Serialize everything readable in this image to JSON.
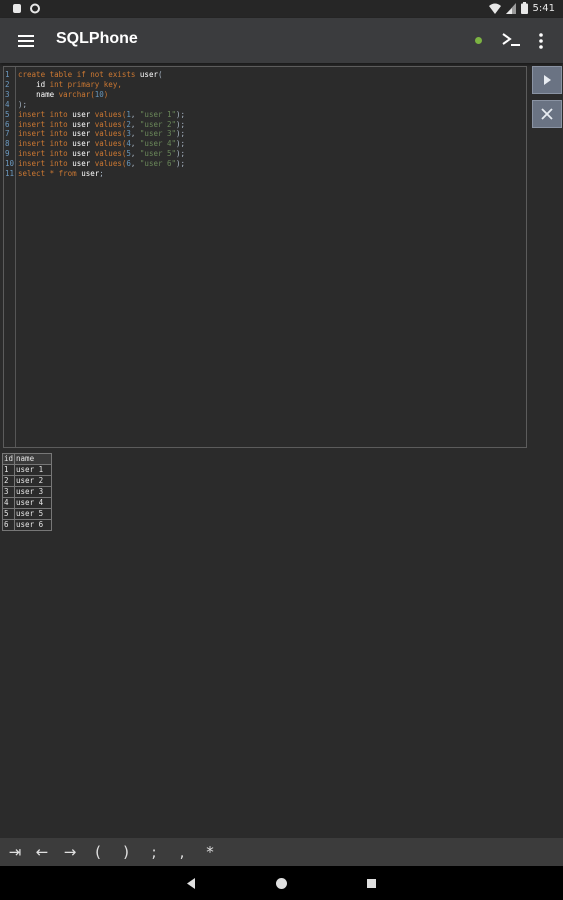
{
  "status": {
    "time": "5:41"
  },
  "app": {
    "title": "SQLPhone"
  },
  "editor": {
    "lines": [
      {
        "n": "1",
        "segs": [
          [
            "create table if not exists ",
            "#cc7832"
          ],
          [
            "user",
            "#ffffff"
          ],
          [
            "(",
            "#a9b7c6"
          ]
        ]
      },
      {
        "n": "2",
        "segs": [
          [
            "    ",
            "#a9b7c6"
          ],
          [
            "id",
            "#ffffff"
          ],
          [
            " int primary key,",
            "#cc7832"
          ]
        ]
      },
      {
        "n": "3",
        "segs": [
          [
            "    ",
            "#a9b7c6"
          ],
          [
            "name",
            "#ffffff"
          ],
          [
            " varchar(",
            "#cc7832"
          ],
          [
            "10",
            "#6897bb"
          ],
          [
            ")",
            "#cc7832"
          ]
        ]
      },
      {
        "n": "4",
        "segs": [
          [
            ");",
            "#a9b7c6"
          ]
        ]
      },
      {
        "n": "5",
        "segs": [
          [
            "insert into ",
            "#cc7832"
          ],
          [
            "user",
            "#ffffff"
          ],
          [
            " values(",
            "#cc7832"
          ],
          [
            "1",
            "#6897bb"
          ],
          [
            ", ",
            "#a9b7c6"
          ],
          [
            "\"user 1\"",
            "#6a8759"
          ],
          [
            ");",
            "#a9b7c6"
          ]
        ]
      },
      {
        "n": "6",
        "segs": [
          [
            "insert into ",
            "#cc7832"
          ],
          [
            "user",
            "#ffffff"
          ],
          [
            " values(",
            "#cc7832"
          ],
          [
            "2",
            "#6897bb"
          ],
          [
            ", ",
            "#a9b7c6"
          ],
          [
            "\"user 2\"",
            "#6a8759"
          ],
          [
            ");",
            "#a9b7c6"
          ]
        ]
      },
      {
        "n": "7",
        "segs": [
          [
            "insert into ",
            "#cc7832"
          ],
          [
            "user",
            "#ffffff"
          ],
          [
            " values(",
            "#cc7832"
          ],
          [
            "3",
            "#6897bb"
          ],
          [
            ", ",
            "#a9b7c6"
          ],
          [
            "\"user 3\"",
            "#6a8759"
          ],
          [
            ");",
            "#a9b7c6"
          ]
        ]
      },
      {
        "n": "8",
        "segs": [
          [
            "insert into ",
            "#cc7832"
          ],
          [
            "user",
            "#ffffff"
          ],
          [
            " values(",
            "#cc7832"
          ],
          [
            "4",
            "#6897bb"
          ],
          [
            ", ",
            "#a9b7c6"
          ],
          [
            "\"user 4\"",
            "#6a8759"
          ],
          [
            ");",
            "#a9b7c6"
          ]
        ]
      },
      {
        "n": "9",
        "segs": [
          [
            "insert into ",
            "#cc7832"
          ],
          [
            "user",
            "#ffffff"
          ],
          [
            " values(",
            "#cc7832"
          ],
          [
            "5",
            "#6897bb"
          ],
          [
            ", ",
            "#a9b7c6"
          ],
          [
            "\"user 5\"",
            "#6a8759"
          ],
          [
            ");",
            "#a9b7c6"
          ]
        ]
      },
      {
        "n": "10",
        "segs": [
          [
            "insert into ",
            "#cc7832"
          ],
          [
            "user",
            "#ffffff"
          ],
          [
            " values(",
            "#cc7832"
          ],
          [
            "6",
            "#6897bb"
          ],
          [
            ", ",
            "#a9b7c6"
          ],
          [
            "\"user 6\"",
            "#6a8759"
          ],
          [
            ");",
            "#a9b7c6"
          ]
        ]
      },
      {
        "n": "11",
        "segs": [
          [
            "select * from ",
            "#cc7832"
          ],
          [
            "user",
            "#ffffff"
          ],
          [
            ";",
            "#a9b7c6"
          ]
        ]
      }
    ]
  },
  "sidebar_buttons": {
    "run_icon": "play-icon",
    "clear_icon": "close-icon"
  },
  "results": {
    "headers": [
      "id",
      "name"
    ],
    "rows": [
      [
        "1",
        "user 1"
      ],
      [
        "2",
        "user 2"
      ],
      [
        "3",
        "user 3"
      ],
      [
        "4",
        "user 4"
      ],
      [
        "5",
        "user 5"
      ],
      [
        "6",
        "user 6"
      ]
    ]
  },
  "keybar": {
    "keys": [
      {
        "name": "tab-key",
        "label": "⇥"
      },
      {
        "name": "left-arrow-key",
        "label": "←"
      },
      {
        "name": "right-arrow-key",
        "label": "→"
      },
      {
        "name": "open-paren-key",
        "label": "("
      },
      {
        "name": "close-paren-key",
        "label": ")"
      },
      {
        "name": "semicolon-key",
        "label": ";"
      },
      {
        "name": "comma-key",
        "label": ","
      },
      {
        "name": "asterisk-key",
        "label": "*"
      }
    ]
  },
  "colors": {
    "status_dot": "#7cb342",
    "toolbar": "#3b3c3e",
    "background": "#2b2b2b",
    "side_button": "#6a7383"
  }
}
